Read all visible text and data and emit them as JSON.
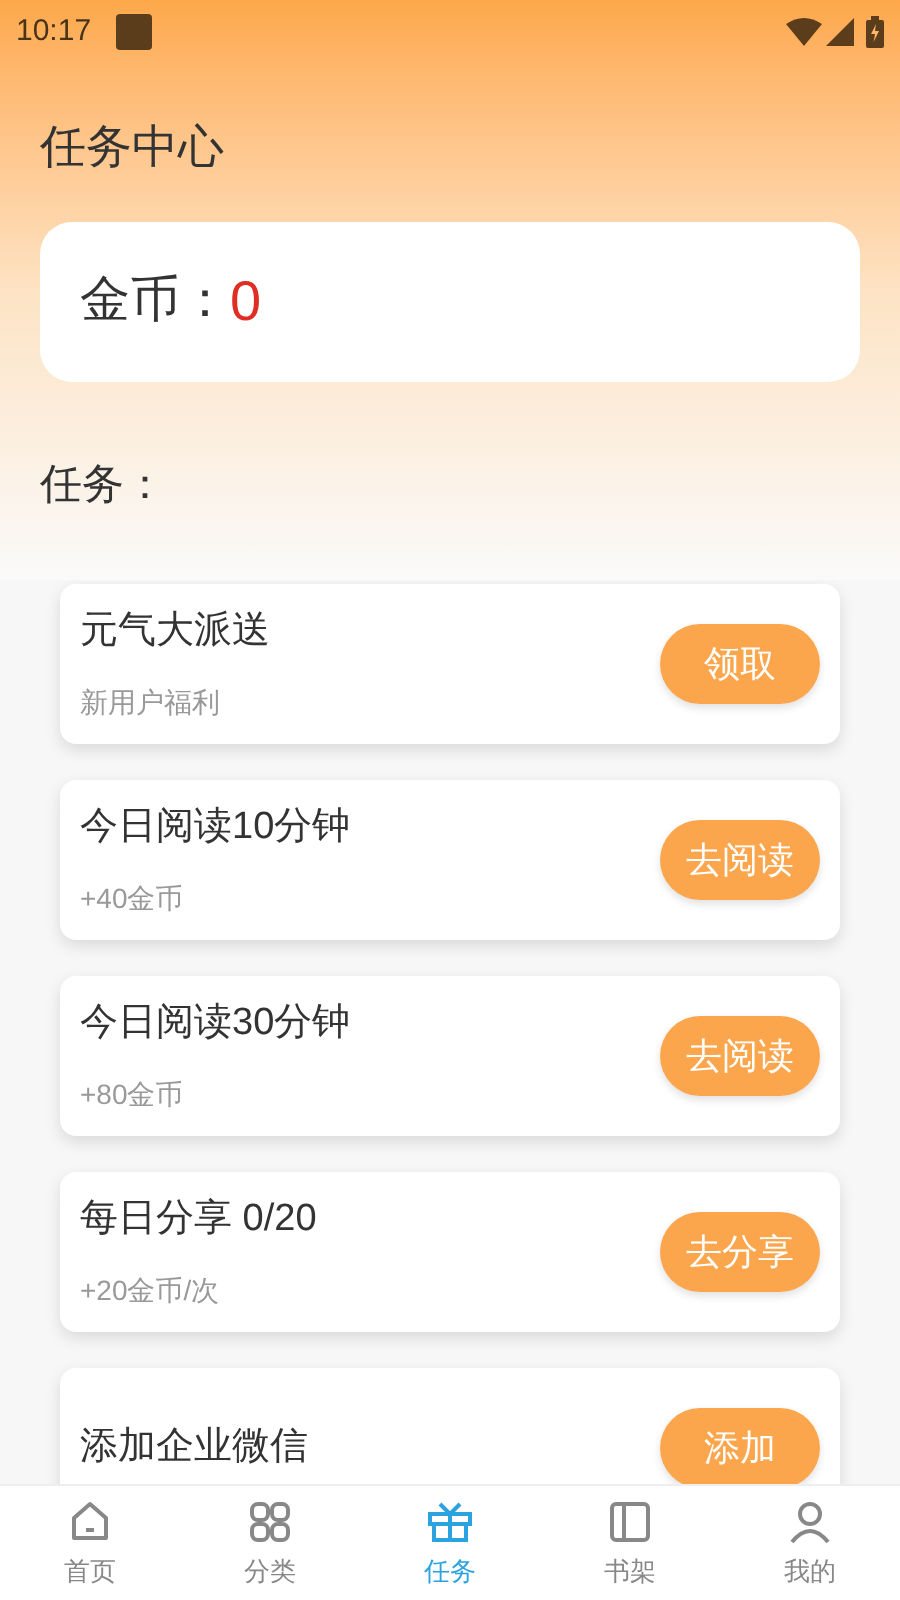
{
  "status_bar": {
    "time": "10:17"
  },
  "title": "任务中心",
  "coins": {
    "label": "金币：",
    "value": "0"
  },
  "tasks_heading": "任务：",
  "tasks": [
    {
      "title": "元气大派送",
      "subtitle": "新用户福利",
      "button": "领取"
    },
    {
      "title": "今日阅读10分钟",
      "subtitle": "+40金币",
      "button": "去阅读"
    },
    {
      "title": "今日阅读30分钟",
      "subtitle": "+80金币",
      "button": "去阅读"
    },
    {
      "title": "每日分享 0/20",
      "subtitle": "+20金币/次",
      "button": "去分享"
    },
    {
      "title": "添加企业微信",
      "button": "添加"
    }
  ],
  "tab_bar": [
    {
      "kind": "home",
      "label": "首页",
      "selected": false
    },
    {
      "kind": "grid",
      "label": "分类",
      "selected": false
    },
    {
      "kind": "gift",
      "label": "任务",
      "selected": true
    },
    {
      "kind": "shelf",
      "label": "书架",
      "selected": false
    },
    {
      "kind": "user",
      "label": "我的",
      "selected": false
    }
  ]
}
